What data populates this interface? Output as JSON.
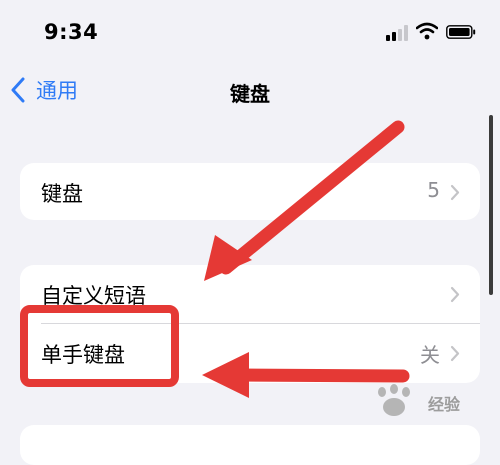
{
  "status_bar": {
    "time": "9:34"
  },
  "nav": {
    "back_label": "通用",
    "title": "键盘"
  },
  "group1": {
    "keyboards": {
      "label": "键盘",
      "value": "5"
    }
  },
  "group2": {
    "text_replacement": {
      "label": "自定义短语"
    },
    "one_handed": {
      "label": "单手键盘",
      "value": "关"
    }
  },
  "watermark": {
    "text": "经验"
  },
  "colors": {
    "accent": "#2f7bf6",
    "annotation_red": "#e53935",
    "background": "#f2f2f7"
  }
}
